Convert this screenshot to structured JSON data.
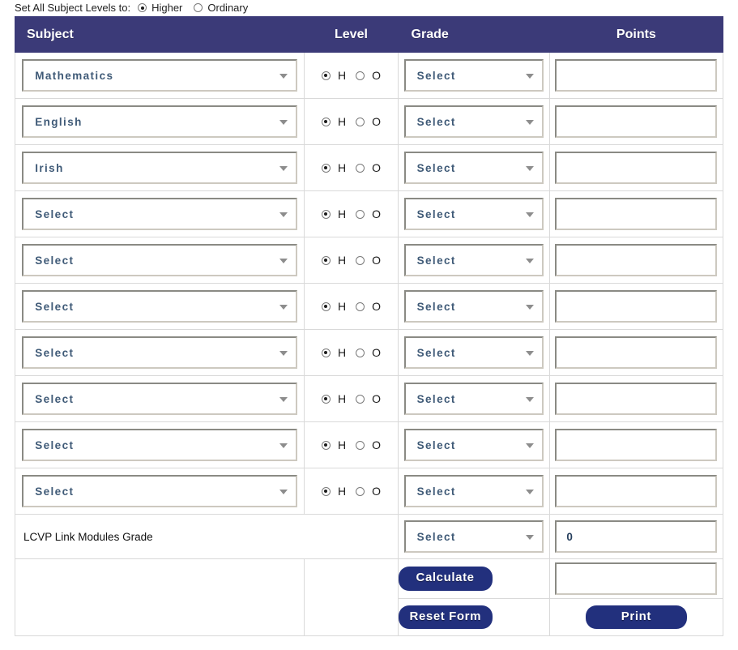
{
  "top_bar": {
    "label": "Set All Subject Levels to:",
    "options": [
      {
        "label": "Higher",
        "checked": true
      },
      {
        "label": "Ordinary",
        "checked": false
      }
    ]
  },
  "table": {
    "headers": {
      "subject": "Subject",
      "level": "Level",
      "grade": "Grade",
      "points": "Points"
    },
    "level_options": {
      "higher": "H",
      "ordinary": "O"
    },
    "rows": [
      {
        "subject": "Mathematics",
        "level_checked": "H",
        "grade": "Select",
        "points": ""
      },
      {
        "subject": "English",
        "level_checked": "H",
        "grade": "Select",
        "points": ""
      },
      {
        "subject": "Irish",
        "level_checked": "H",
        "grade": "Select",
        "points": ""
      },
      {
        "subject": "Select",
        "level_checked": "H",
        "grade": "Select",
        "points": ""
      },
      {
        "subject": "Select",
        "level_checked": "H",
        "grade": "Select",
        "points": ""
      },
      {
        "subject": "Select",
        "level_checked": "H",
        "grade": "Select",
        "points": ""
      },
      {
        "subject": "Select",
        "level_checked": "H",
        "grade": "Select",
        "points": ""
      },
      {
        "subject": "Select",
        "level_checked": "H",
        "grade": "Select",
        "points": ""
      },
      {
        "subject": "Select",
        "level_checked": "H",
        "grade": "Select",
        "points": ""
      },
      {
        "subject": "Select",
        "level_checked": "H",
        "grade": "Select",
        "points": ""
      }
    ],
    "lcvp": {
      "label": "LCVP Link Modules Grade",
      "grade": "Select",
      "points": "0"
    },
    "total": {
      "points": ""
    }
  },
  "buttons": {
    "calculate": "Calculate",
    "reset": "Reset Form",
    "print": "Print"
  },
  "colors": {
    "header_bar": "#3b3a78",
    "button": "#22307d",
    "select_text": "#3f5a77"
  }
}
